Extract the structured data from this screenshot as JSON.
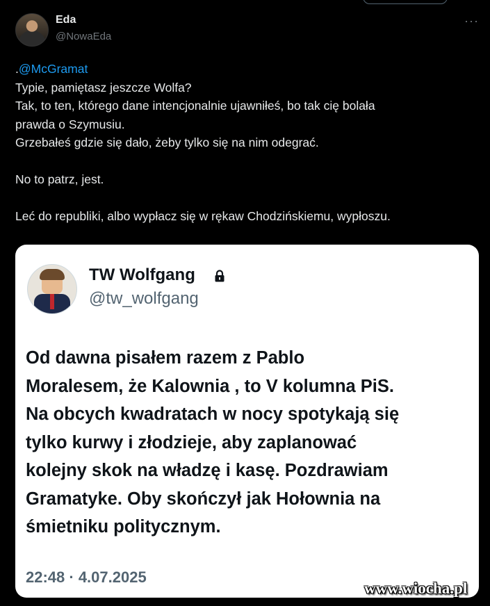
{
  "post": {
    "author_name": "Eda",
    "author_handle": "@NowaEda",
    "more_icon": "more-dots-icon",
    "mention": "@McGramat",
    "lines": [
      "Typie, pamiętasz jeszcze Wolfa?",
      "Tak, to ten, którego dane intencjonalnie ujawniłeś, bo tak cię bolała",
      "prawda o Szymusiu.",
      "Grzebałeś gdzie się dało, żeby tylko się na nim odegrać.",
      "No to patrz, jest.",
      "Leć do republiki, albo wypłacz się w rękaw Chodzińskiemu, wypłoszu."
    ]
  },
  "embedded_tweet": {
    "author_name": "TW Wolfgang",
    "author_handle": "@tw_wolfgang",
    "lock_icon": "lock-icon",
    "lines": [
      "Od dawna pisałem razem z Pablo",
      "Moralesem, że Kalownia , to V kolumna PiS.",
      "Na obcych kwadratach w nocy spotykają się",
      "tylko kurwy i złodzieje, aby zaplanować",
      "kolejny skok na władzę i kasę. Pozdrawiam",
      "Gramatyke. Oby skończył jak Hołownia na",
      "śmietniku politycznym."
    ],
    "timestamp": "22:48 · 4.07.2025"
  },
  "watermark": "www.wiocha.pl",
  "colors": {
    "background": "#000000",
    "text": "#e7e9ea",
    "secondary": "#71767b",
    "mention": "#1d9bf0",
    "card": "#ffffff"
  }
}
